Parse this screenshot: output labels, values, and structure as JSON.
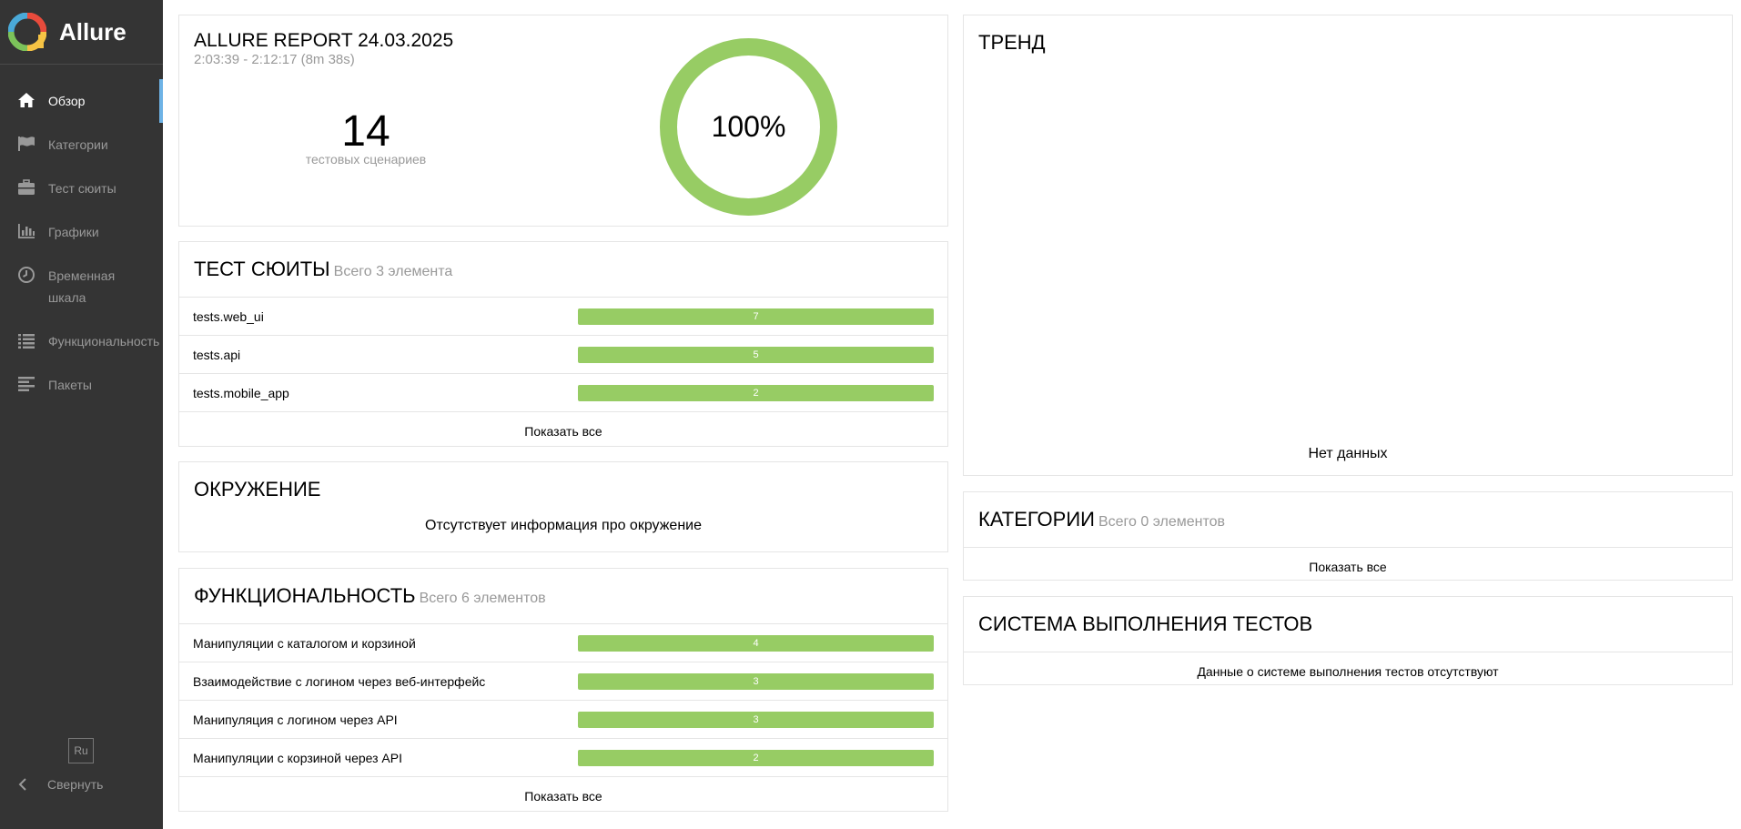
{
  "app": {
    "name": "Allure"
  },
  "sidebar": {
    "items": [
      {
        "label": "Обзор",
        "icon": "home-icon",
        "active": true
      },
      {
        "label": "Категории",
        "icon": "flag-icon",
        "active": false
      },
      {
        "label": "Тест сюиты",
        "icon": "briefcase-icon",
        "active": false
      },
      {
        "label": "Графики",
        "icon": "bar-chart-icon",
        "active": false
      },
      {
        "label": "Временная шкала",
        "icon": "clock-icon",
        "active": false
      },
      {
        "label": "Функциональность",
        "icon": "list-icon",
        "active": false
      },
      {
        "label": "Пакеты",
        "icon": "align-left-icon",
        "active": false
      }
    ],
    "language": "Ru",
    "collapse_label": "Свернуть"
  },
  "summary": {
    "title": "ALLURE REPORT 24.03.2025",
    "time": "2:03:39 - 2:12:17 (8m 38s)",
    "test_count": "14",
    "test_count_label": "тестовых сценариев",
    "pass_percent_label": "100%",
    "pass_fraction": 1.0,
    "passed_color": "#97cc64"
  },
  "suites": {
    "title": "ТЕСТ СЮИТЫ",
    "subtitle": "Всего 3 элемента",
    "rows": [
      {
        "name": "tests.web_ui",
        "count": "7"
      },
      {
        "name": "tests.api",
        "count": "5"
      },
      {
        "name": "tests.mobile_app",
        "count": "2"
      }
    ],
    "show_all": "Показать все"
  },
  "environment": {
    "title": "ОКРУЖЕНИЕ",
    "message": "Отсутствует информация про окружение"
  },
  "features": {
    "title": "ФУНКЦИОНАЛЬНОСТЬ",
    "subtitle": "Всего 6 элементов",
    "rows": [
      {
        "name": "Манипуляции с каталогом и корзиной",
        "count": "4"
      },
      {
        "name": "Взаимодействие с логином через веб-интерфейс",
        "count": "3"
      },
      {
        "name": "Манипуляция с логином через API",
        "count": "3"
      },
      {
        "name": "Манипуляции с корзиной через API",
        "count": "2"
      }
    ],
    "show_all": "Показать все"
  },
  "trend": {
    "title": "ТРЕНД",
    "empty": "Нет данных"
  },
  "categories": {
    "title": "КАТЕГОРИИ",
    "subtitle": "Всего 0 элементов",
    "show_all": "Показать все"
  },
  "executors": {
    "title": "СИСТЕМА ВЫПОЛНЕНИЯ ТЕСТОВ",
    "message": "Данные о системе выполнения тестов отсутствуют"
  }
}
